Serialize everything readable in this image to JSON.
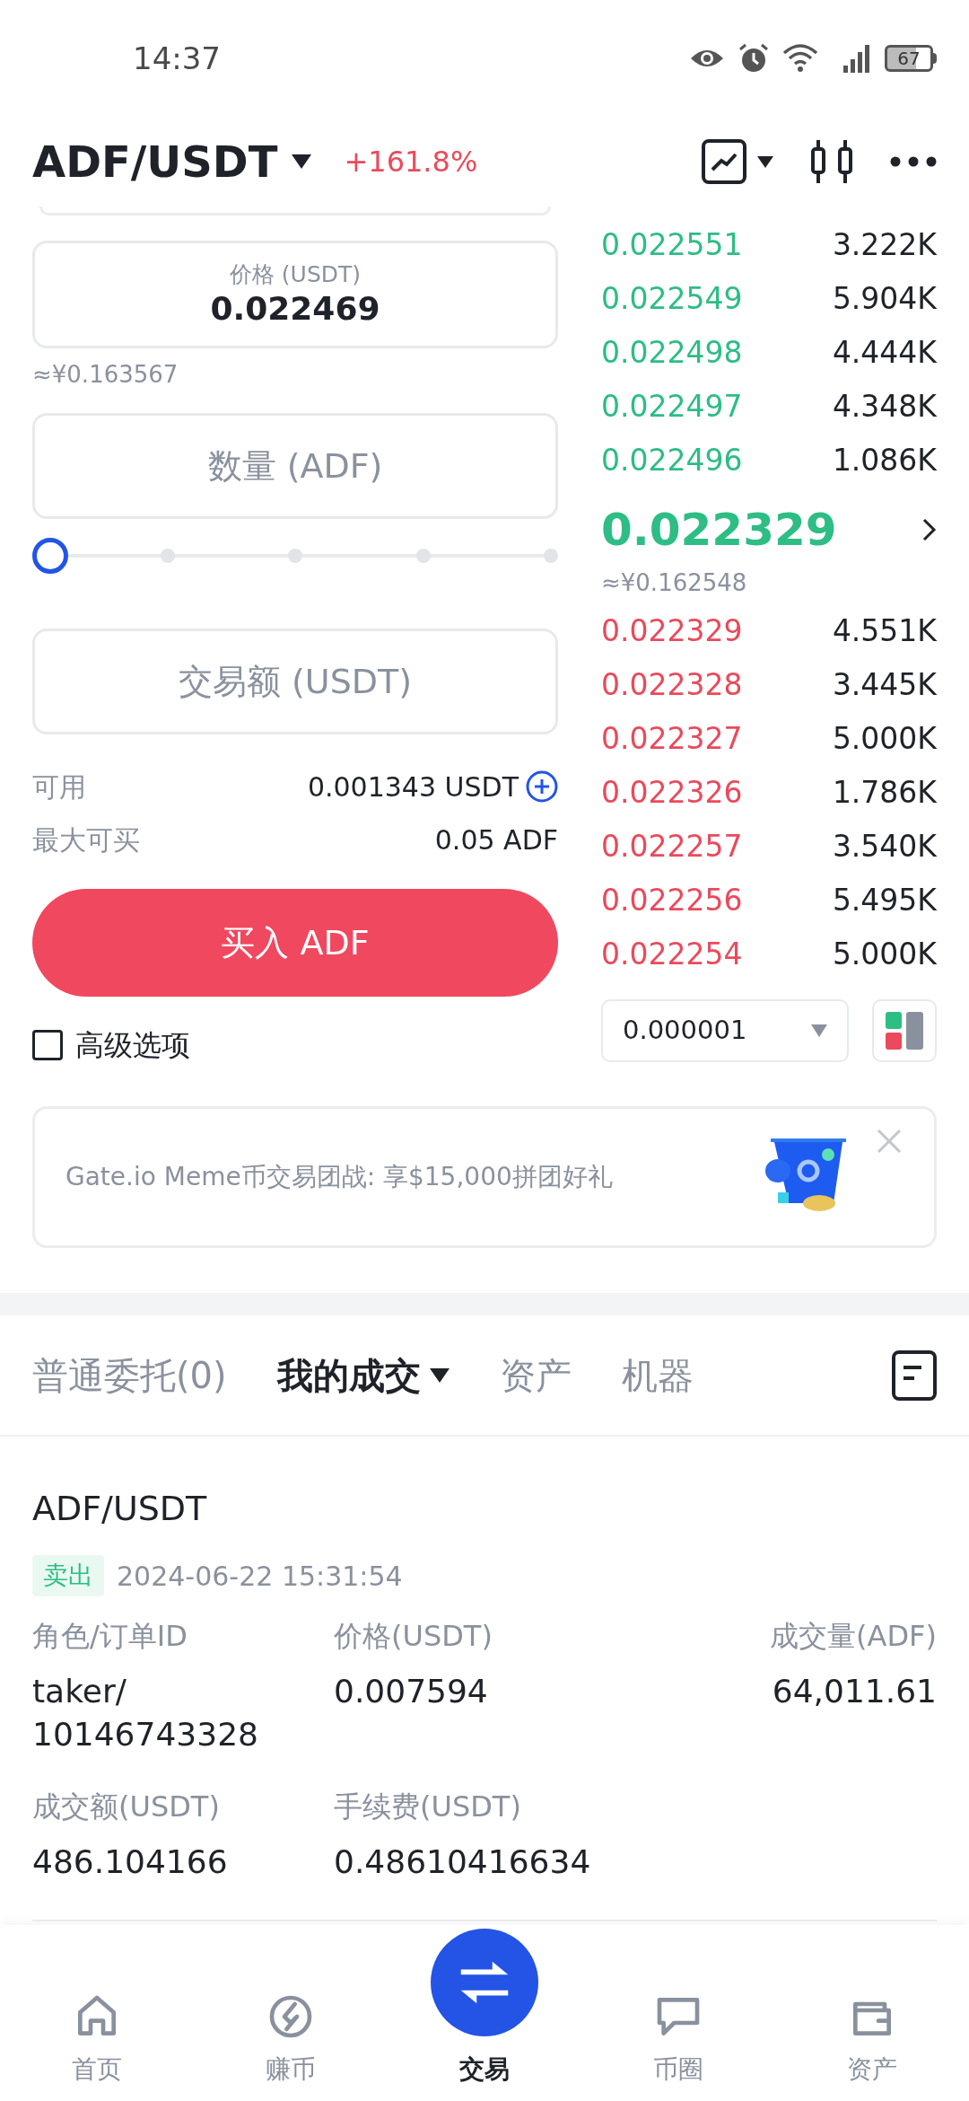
{
  "status_bar": {
    "time": "14:37",
    "battery": "67"
  },
  "header": {
    "pair": "ADF/USDT",
    "change": "+161.8%"
  },
  "order_form": {
    "price_label": "价格 (USDT)",
    "price_value": "0.022469",
    "price_cny": "≈¥0.163567",
    "quantity_placeholder": "数量 (ADF)",
    "slider": {
      "level": 0
    },
    "amount_placeholder": "交易额 (USDT)",
    "available_label": "可用",
    "available_value": "0.001343 USDT",
    "max_label": "最大可买",
    "max_value": "0.05 ADF",
    "buy_button": "买入 ADF",
    "advanced": {
      "label": "高级选项",
      "checked": false
    }
  },
  "order_book": {
    "asks": [
      {
        "price": "0.022551",
        "amount": "3.222K"
      },
      {
        "price": "0.022549",
        "amount": "5.904K"
      },
      {
        "price": "0.022498",
        "amount": "4.444K"
      },
      {
        "price": "0.022497",
        "amount": "4.348K"
      },
      {
        "price": "0.022496",
        "amount": "1.086K"
      }
    ],
    "last_price": "0.022329",
    "last_price_cny": "≈¥0.162548",
    "bids": [
      {
        "price": "0.022329",
        "amount": "4.551K"
      },
      {
        "price": "0.022328",
        "amount": "3.445K"
      },
      {
        "price": "0.022327",
        "amount": "5.000K"
      },
      {
        "price": "0.022326",
        "amount": "1.786K"
      },
      {
        "price": "0.022257",
        "amount": "3.540K"
      },
      {
        "price": "0.022256",
        "amount": "5.495K"
      },
      {
        "price": "0.022254",
        "amount": "5.000K"
      }
    ],
    "precision": "0.000001"
  },
  "banner": {
    "text": "Gate.io Meme币交易团战: 享$15,000拼团好礼"
  },
  "tabs": [
    {
      "label": "普通委托(0)",
      "selected": false
    },
    {
      "label": "我的成交",
      "selected": true
    },
    {
      "label": "资产",
      "selected": false
    },
    {
      "label": "机器",
      "selected": false
    }
  ],
  "trades": [
    {
      "pair": "ADF/USDT",
      "side": "卖出",
      "time": "2024-06-22 15:31:54",
      "fields": [
        {
          "label": "角色/订单ID",
          "value_lines": [
            "taker/",
            "10146743328"
          ]
        },
        {
          "label": "价格(USDT)",
          "value_lines": [
            "0.007594"
          ]
        },
        {
          "label": "成交量(ADF)",
          "value_lines": [
            "64,011.61"
          ]
        },
        {
          "label": "成交额(USDT)",
          "value_lines": [
            "486.104166"
          ]
        },
        {
          "label": "手续费(USDT)",
          "value_lines": [
            "0.48610416634"
          ]
        }
      ]
    }
  ],
  "nav": [
    {
      "label": "首页",
      "kind": "home",
      "selected": false
    },
    {
      "label": "赚币",
      "kind": "earn",
      "selected": false
    },
    {
      "label": "交易",
      "kind": "trade",
      "selected": true
    },
    {
      "label": "币圈",
      "kind": "chat",
      "selected": false
    },
    {
      "label": "资产",
      "kind": "wallet",
      "selected": false
    }
  ]
}
